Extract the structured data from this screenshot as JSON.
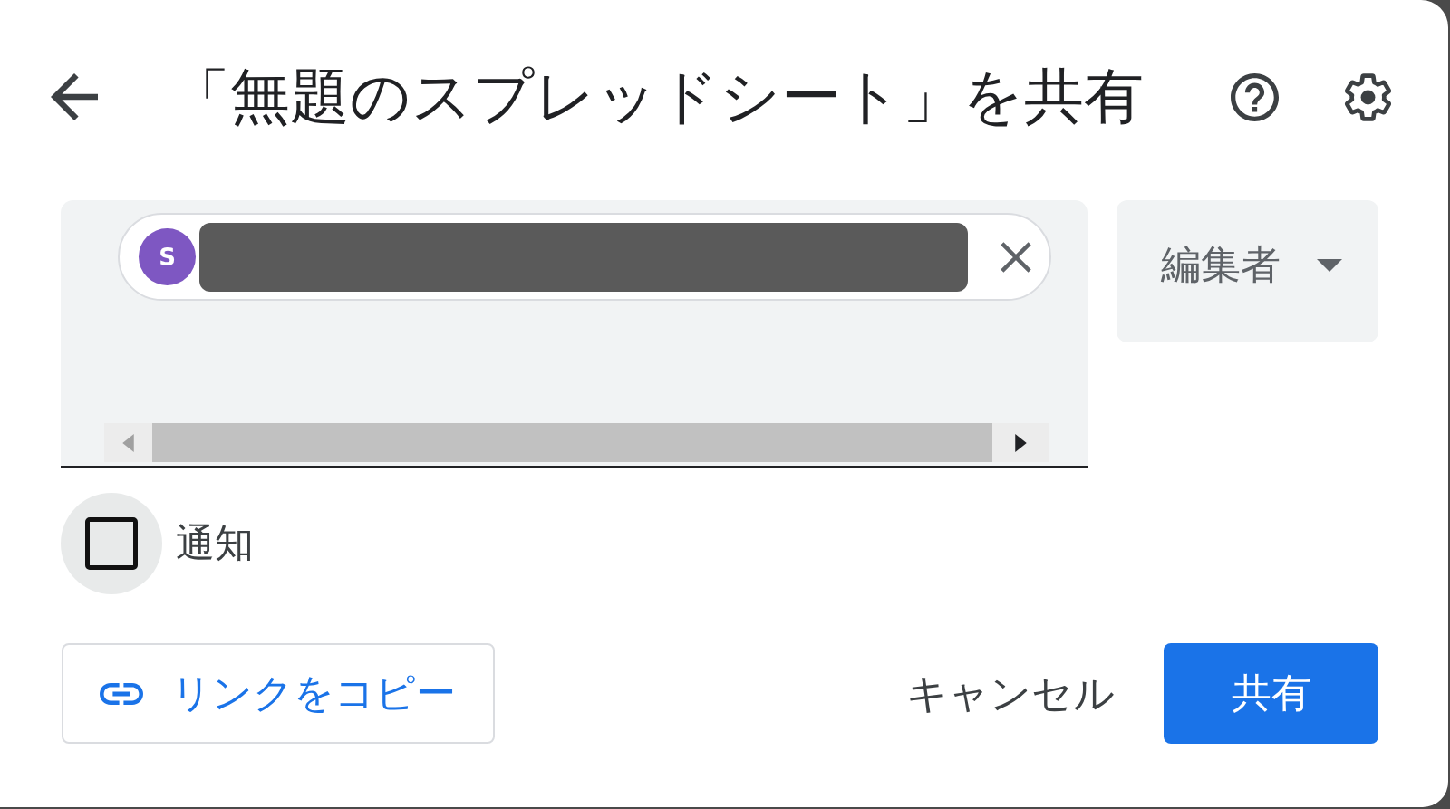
{
  "dialog": {
    "title": "「無題のスプレッドシート」を共有"
  },
  "recipients": [
    {
      "initial": "S"
    }
  ],
  "role": {
    "label": "編集者"
  },
  "notify": {
    "label": "通知",
    "checked": false
  },
  "buttons": [
    {
      "kind": "outlined",
      "label": "リンクをコピー"
    },
    {
      "kind": "text",
      "label": "キャンセル"
    },
    {
      "kind": "filled",
      "label": "共有"
    }
  ]
}
